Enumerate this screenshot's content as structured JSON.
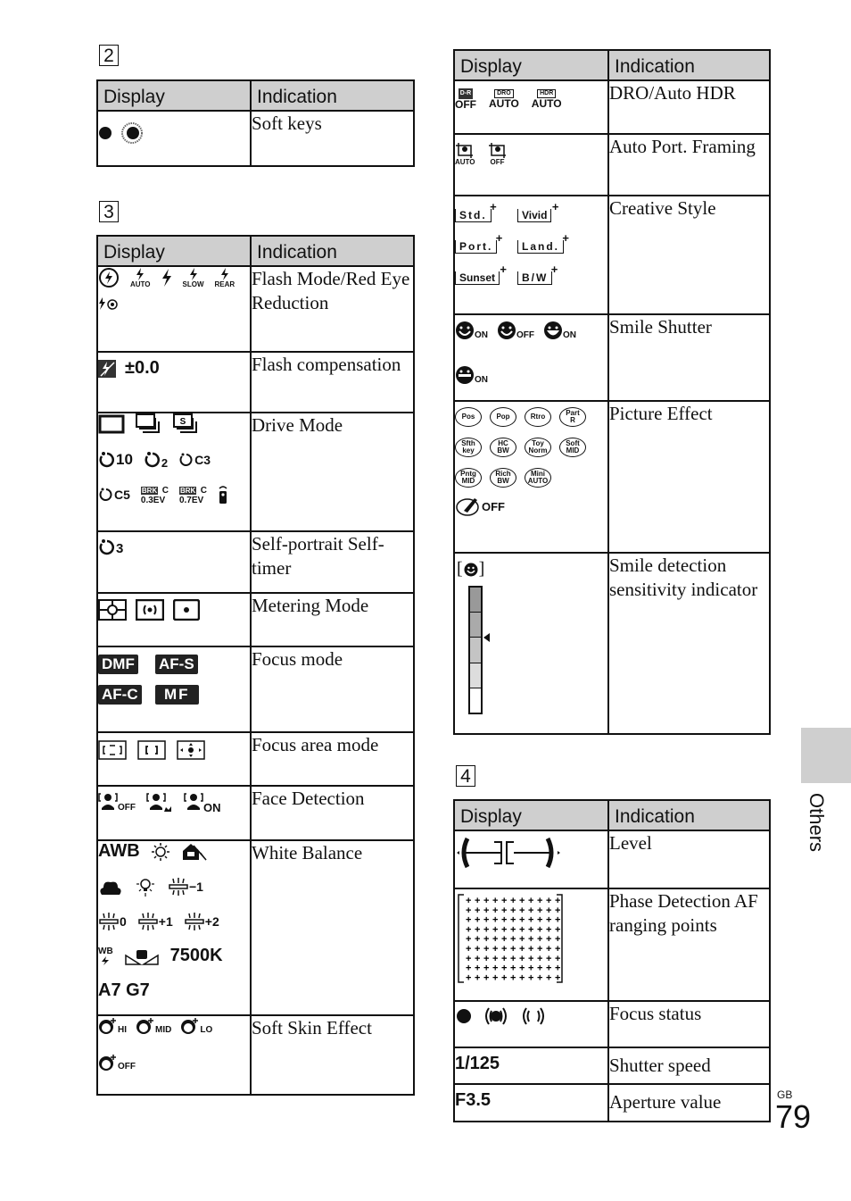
{
  "page": {
    "side_tab_label": "Others",
    "region_code": "GB",
    "page_number": "79"
  },
  "columns": {
    "display": "Display",
    "indication": "Indication"
  },
  "section2": {
    "number": "2",
    "rows": [
      {
        "icons": [
          "soft-key-dot",
          "soft-key-dial"
        ],
        "indication": "Soft keys"
      }
    ]
  },
  "section3": {
    "number": "3",
    "rows": [
      {
        "indication": "Flash Mode/Red Eye Reduction",
        "icons": [
          "flash-off",
          "flash-auto",
          "fill-flash",
          "slow-sync",
          "rear-sync",
          "red-eye"
        ],
        "labels": {
          "auto": "AUTO",
          "slow": "SLOW",
          "rear": "REAR"
        }
      },
      {
        "indication": "Flash compensation",
        "value": "±0.0"
      },
      {
        "indication": "Drive Mode",
        "labels": {
          "t10": "10",
          "t2": "2",
          "c3": "C3",
          "c5": "C5",
          "brk03": "0.3EV",
          "brk07": "0.7EV",
          "brk": "BRK",
          "c": "C",
          "s": "S"
        }
      },
      {
        "indication": "Self-portrait Self-timer",
        "labels": {
          "t3": "3"
        }
      },
      {
        "indication": "Metering Mode"
      },
      {
        "indication": "Focus mode",
        "badges": [
          "DMF",
          "AF-S",
          "AF-C",
          "MF"
        ]
      },
      {
        "indication": "Focus area mode"
      },
      {
        "indication": "Face Detection",
        "labels": {
          "off": "OFF",
          "on": "ON"
        }
      },
      {
        "indication": "White Balance",
        "labels": {
          "awb": "AWB",
          "m1": "−1",
          "z": "0",
          "p1": "+1",
          "p2": "+2",
          "wb": "WB",
          "kelvin": "7500K",
          "ag": "A7 G7"
        }
      },
      {
        "indication": "Soft Skin Effect",
        "labels": {
          "hi": "HI",
          "mid": "MID",
          "lo": "LO",
          "off": "OFF"
        }
      }
    ]
  },
  "section_right": {
    "rows": [
      {
        "indication": "DRO/Auto HDR",
        "labels": {
          "dr": "D-R",
          "off": "OFF",
          "dro": "DRO",
          "auto": "AUTO",
          "hdr": "HDR"
        }
      },
      {
        "indication": "Auto Port. Framing",
        "labels": {
          "auto": "AUTO",
          "off": "OFF"
        }
      },
      {
        "indication": "Creative Style",
        "styles": [
          "Std.",
          "Vivid",
          "Port.",
          "Land.",
          "Sunset",
          "B/W"
        ]
      },
      {
        "indication": "Smile Shutter",
        "labels": {
          "on": "ON",
          "off": "OFF"
        }
      },
      {
        "indication": "Picture Effect",
        "effects": [
          [
            "Pos",
            ""
          ],
          [
            "Pop",
            ""
          ],
          [
            "Rtro",
            ""
          ],
          [
            "Part",
            "R"
          ],
          [
            "Sfth",
            "key"
          ],
          [
            "HC",
            "BW"
          ],
          [
            "Toy",
            "Norm"
          ],
          [
            "Soft",
            "MID"
          ],
          [
            "Pntg",
            "MID"
          ],
          [
            "Rich",
            "BW"
          ],
          [
            "Mini",
            "AUTO"
          ]
        ],
        "off_label": "OFF"
      },
      {
        "indication": "Smile detection sensitivity indicator",
        "level_segments": 5,
        "level_marker": 3
      }
    ]
  },
  "section4": {
    "number": "4",
    "rows": [
      {
        "indication": "Level"
      },
      {
        "indication": "Phase Detection AF ranging points",
        "grid_cols": 11,
        "grid_rows": 9
      },
      {
        "indication": "Focus status"
      },
      {
        "indication": "Shutter speed",
        "value": "1/125"
      },
      {
        "indication": "Aperture value",
        "value": "F3.5"
      }
    ]
  }
}
